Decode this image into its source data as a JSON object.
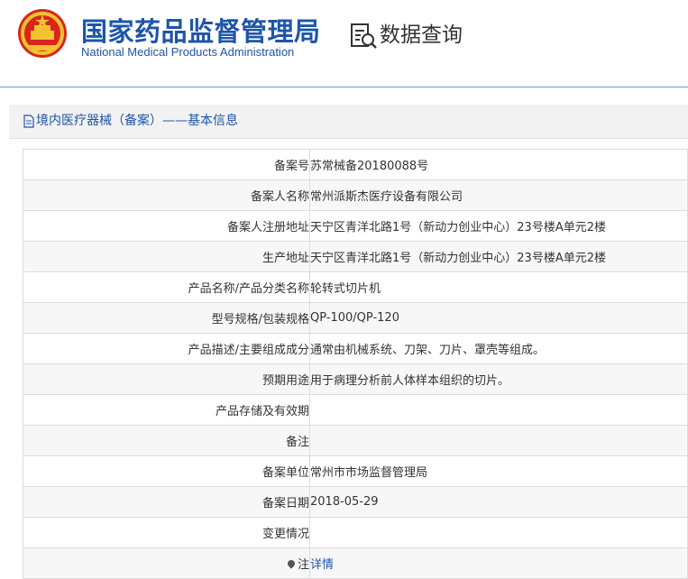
{
  "header": {
    "title_cn": "国家药品监督管理局",
    "title_en": "National Medical Products Administration",
    "query_label": "数据查询",
    "accent_color": "#1e55a8",
    "emblem_icon": "national-emblem-icon",
    "query_icon": "document-search-icon"
  },
  "section": {
    "icon": "document-icon",
    "title": "境内医疗器械（备案）——基本信息"
  },
  "rows": [
    {
      "label": "备案号",
      "value": "苏常械备20180088号"
    },
    {
      "label": "备案人名称",
      "value": "常州派斯杰医疗设备有限公司"
    },
    {
      "label": "备案人注册地址",
      "value": "天宁区青洋北路1号（新动力创业中心）23号楼A单元2楼"
    },
    {
      "label": "生产地址",
      "value": "天宁区青洋北路1号（新动力创业中心）23号楼A单元2楼"
    },
    {
      "label": "产品名称/产品分类名称",
      "value": "轮转式切片机"
    },
    {
      "label": "型号规格/包装规格",
      "value": "QP-100/QP-120"
    },
    {
      "label": "产品描述/主要组成成分",
      "value": "通常由机械系统、刀架、刀片、罩壳等组成。"
    },
    {
      "label": "预期用途",
      "value": "用于病理分析前人体样本组织的切片。"
    },
    {
      "label": "产品存储及有效期",
      "value": ""
    },
    {
      "label": "备注",
      "value": ""
    },
    {
      "label": "备案单位",
      "value": "常州市市场监督管理局"
    },
    {
      "label": "备案日期",
      "value": "2018-05-29"
    },
    {
      "label": "变更情况",
      "value": ""
    },
    {
      "label": "注",
      "value": "详情",
      "icon": "pin-icon"
    }
  ]
}
